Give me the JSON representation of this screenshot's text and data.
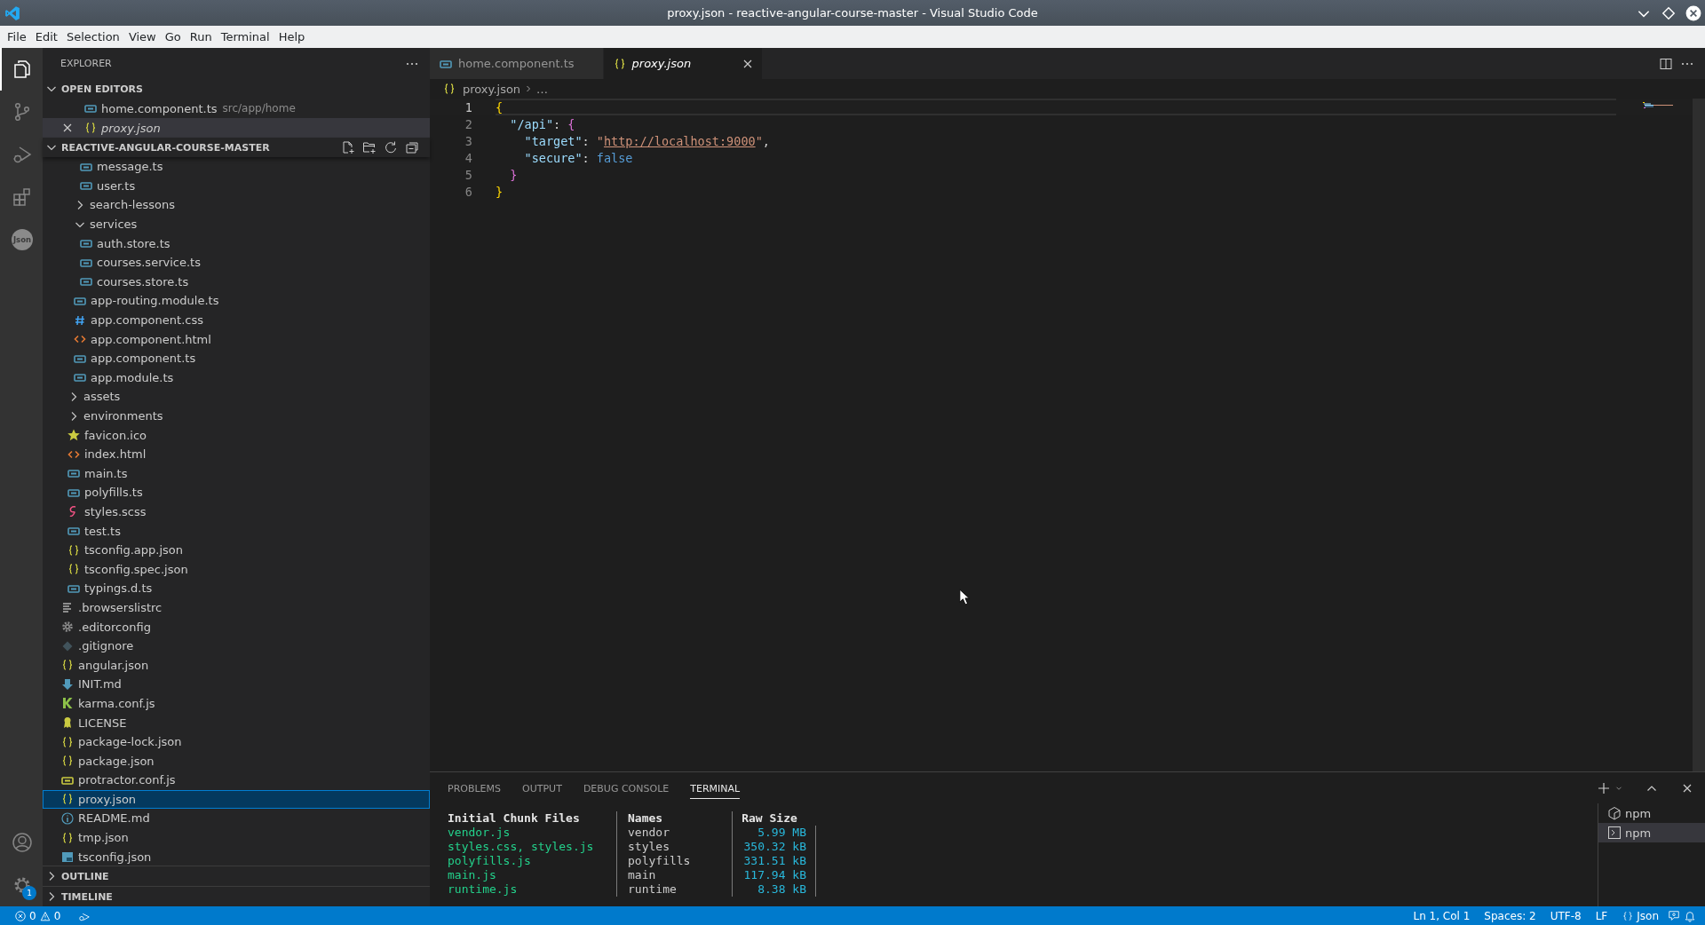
{
  "window": {
    "title": "proxy.json - reactive-angular-course-master - Visual Studio Code"
  },
  "menu": [
    "File",
    "Edit",
    "Selection",
    "View",
    "Go",
    "Run",
    "Terminal",
    "Help"
  ],
  "activity_bar": {
    "items": [
      {
        "kind": "files",
        "selected": true
      },
      {
        "kind": "source-control",
        "selected": false
      },
      {
        "kind": "run-debug",
        "selected": false
      },
      {
        "kind": "extensions",
        "selected": false
      },
      {
        "kind": "json",
        "label": "Json",
        "selected": false
      }
    ],
    "bottom": [
      {
        "kind": "account"
      },
      {
        "kind": "settings",
        "badge": "1"
      }
    ]
  },
  "explorer": {
    "title": "EXPLORER",
    "open_editors": {
      "title": "OPEN EDITORS",
      "expanded": true,
      "items": [
        {
          "label": "home.component.ts",
          "kind": "ts",
          "description": "src/app/home",
          "preview": false,
          "selected": false
        },
        {
          "label": "proxy.json",
          "kind": "json",
          "preview": true,
          "selected": true
        }
      ]
    },
    "folder": {
      "title": "REACTIVE-ANGULAR-COURSE-MASTER",
      "expanded": true,
      "tree": [
        {
          "children": [
            {
              "children": [
                {
                  "children": [
                    {
                      "label": "message.ts",
                      "kind": "ts",
                      "selected": false
                    },
                    {
                      "label": "user.ts",
                      "kind": "ts",
                      "selected": false
                    }
                  ]
                },
                {
                  "label": "search-lessons",
                  "kind": "folder",
                  "expanded": false,
                  "selected": false
                },
                {
                  "label": "services",
                  "kind": "folder",
                  "expanded": true,
                  "selected": false,
                  "children": [
                    {
                      "label": "auth.store.ts",
                      "kind": "ts",
                      "selected": false
                    },
                    {
                      "label": "courses.service.ts",
                      "kind": "ts",
                      "selected": false
                    },
                    {
                      "label": "courses.store.ts",
                      "kind": "ts",
                      "selected": false
                    }
                  ]
                },
                {
                  "label": "app-routing.module.ts",
                  "kind": "ts",
                  "selected": false
                },
                {
                  "label": "app.component.css",
                  "kind": "css",
                  "selected": false
                },
                {
                  "label": "app.component.html",
                  "kind": "html",
                  "selected": false
                },
                {
                  "label": "app.component.ts",
                  "kind": "ts",
                  "selected": false
                },
                {
                  "label": "app.module.ts",
                  "kind": "ts",
                  "selected": false
                }
              ]
            },
            {
              "label": "assets",
              "kind": "folder",
              "expanded": false,
              "selected": false
            },
            {
              "label": "environments",
              "kind": "folder",
              "expanded": false,
              "selected": false
            },
            {
              "label": "favicon.ico",
              "kind": "favicon",
              "selected": false
            },
            {
              "label": "index.html",
              "kind": "html",
              "selected": false
            },
            {
              "label": "main.ts",
              "kind": "ts",
              "selected": false
            },
            {
              "label": "polyfills.ts",
              "kind": "ts",
              "selected": false
            },
            {
              "label": "styles.scss",
              "kind": "sass",
              "selected": false
            },
            {
              "label": "test.ts",
              "kind": "ts",
              "selected": false
            },
            {
              "label": "tsconfig.app.json",
              "kind": "json",
              "selected": false
            },
            {
              "label": "tsconfig.spec.json",
              "kind": "json",
              "selected": false
            },
            {
              "label": "typings.d.ts",
              "kind": "ts",
              "selected": false
            }
          ]
        },
        {
          "label": ".browserslistrc",
          "kind": "config",
          "selected": false
        },
        {
          "label": ".editorconfig",
          "kind": "settings",
          "selected": false
        },
        {
          "label": ".gitignore",
          "kind": "git",
          "selected": false
        },
        {
          "label": "angular.json",
          "kind": "json",
          "selected": false
        },
        {
          "label": "INIT.md",
          "kind": "markdown",
          "selected": false
        },
        {
          "label": "karma.conf.js",
          "kind": "karma",
          "selected": false
        },
        {
          "label": "LICENSE",
          "kind": "license",
          "selected": false
        },
        {
          "label": "package-lock.json",
          "kind": "json",
          "selected": false
        },
        {
          "label": "package.json",
          "kind": "json",
          "selected": false
        },
        {
          "label": "protractor.conf.js",
          "kind": "js",
          "selected": false
        },
        {
          "label": "proxy.json",
          "kind": "json",
          "selected": true
        },
        {
          "label": "README.md",
          "kind": "readme",
          "selected": false
        },
        {
          "label": "tmp.json",
          "kind": "json",
          "selected": false
        },
        {
          "label": "tsconfig.json",
          "kind": "tsconfig",
          "selected": false
        }
      ]
    },
    "sections": [
      {
        "title": "OUTLINE",
        "expanded": false
      },
      {
        "title": "TIMELINE",
        "expanded": false
      }
    ]
  },
  "editor": {
    "tabs": [
      {
        "label": "home.component.ts",
        "kind": "ts",
        "preview": false,
        "selected": false
      },
      {
        "label": "proxy.json",
        "kind": "json",
        "preview": true,
        "selected": true
      }
    ],
    "breadcrumb": [
      "proxy.json",
      "…"
    ],
    "lines": [
      {
        "number": "1",
        "current": true,
        "tokens": [
          {
            "text": "{",
            "kind": "bracket1"
          }
        ]
      },
      {
        "number": "2",
        "current": false,
        "tokens": [
          {
            "text": "  \"/api\"",
            "kind": "key"
          },
          {
            "text": ": ",
            "kind": "punct"
          },
          {
            "text": "{",
            "kind": "bracket2"
          }
        ]
      },
      {
        "number": "3",
        "current": false,
        "tokens": [
          {
            "text": "    \"target\"",
            "kind": "key"
          },
          {
            "text": ": ",
            "kind": "punct"
          },
          {
            "text": "\"",
            "kind": "string"
          },
          {
            "text": "http://localhost:9000",
            "kind": "link"
          },
          {
            "text": "\"",
            "kind": "string"
          },
          {
            "text": ",",
            "kind": "punct"
          }
        ]
      },
      {
        "number": "4",
        "current": false,
        "tokens": [
          {
            "text": "    \"secure\"",
            "kind": "key"
          },
          {
            "text": ": ",
            "kind": "punct"
          },
          {
            "text": "false",
            "kind": "keyword"
          }
        ]
      },
      {
        "number": "5",
        "current": false,
        "tokens": [
          {
            "text": "  }",
            "kind": "bracket2"
          }
        ]
      },
      {
        "number": "6",
        "current": false,
        "tokens": [
          {
            "text": "}",
            "kind": "bracket1"
          }
        ]
      }
    ]
  },
  "panel": {
    "tabs": [
      {
        "label": "PROBLEMS",
        "selected": false
      },
      {
        "label": "OUTPUT",
        "selected": false
      },
      {
        "label": "DEBUG CONSOLE",
        "selected": false
      },
      {
        "label": "TERMINAL",
        "selected": true
      }
    ],
    "terminal": {
      "columns": [
        "Initial Chunk Files",
        "Names",
        "Raw Size"
      ],
      "rows": [
        [
          "vendor.js",
          "vendor",
          "5.99 MB"
        ],
        [
          "styles.css, styles.js",
          "styles",
          "350.32 kB"
        ],
        [
          "polyfills.js",
          "polyfills",
          "331.51 kB"
        ],
        [
          "main.js",
          "main",
          "117.94 kB"
        ],
        [
          "runtime.js",
          "runtime",
          "8.38 kB"
        ]
      ]
    },
    "terminals": [
      {
        "label": "npm",
        "kind": "task",
        "selected": false
      },
      {
        "label": "npm",
        "kind": "shell",
        "selected": true
      }
    ]
  },
  "status_bar": {
    "errors": "0",
    "warnings": "0",
    "items": [
      {
        "text": "Ln 1, Col 1",
        "kind": "plain"
      },
      {
        "text": "Spaces: 2",
        "kind": "plain"
      },
      {
        "text": "UTF-8",
        "kind": "plain"
      },
      {
        "text": "LF",
        "kind": "plain"
      },
      {
        "text": "Json",
        "kind": "language"
      }
    ]
  }
}
